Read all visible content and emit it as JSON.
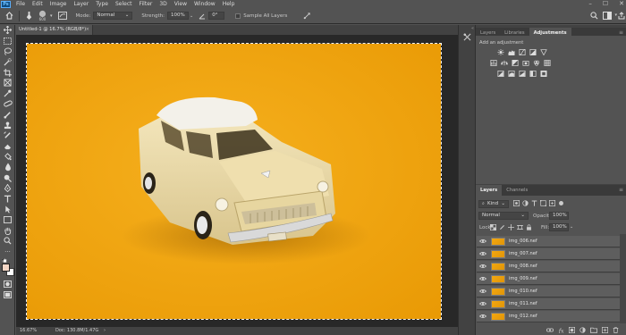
{
  "app": {
    "logo_text": "Ps",
    "menu": [
      "File",
      "Edit",
      "Image",
      "Layer",
      "Type",
      "Select",
      "Filter",
      "3D",
      "View",
      "Window",
      "Help"
    ],
    "window_controls": [
      "–",
      "☐",
      "✕"
    ]
  },
  "options_bar": {
    "brush_size": "600",
    "mode_label": "Mode:",
    "mode_value": "Normal",
    "strength_label": "Strength:",
    "strength_value": "100%",
    "angle_value": "0°",
    "sample_all_label": "Sample All Layers"
  },
  "document": {
    "tab_title": "Untitled-1 @ 16.7% (RGB/8*)",
    "tab_close": "×",
    "zoom": "16.67%",
    "doc_info": "Doc: 130.8M/1.47G"
  },
  "panels": {
    "top_tabs": [
      "Layers",
      "Libraries",
      "Adjustments"
    ],
    "adjustments_hint": "Add an adjustment",
    "layers_tabs": [
      "Layers",
      "Channels"
    ],
    "filter_kind": "Kind",
    "blend_mode": "Normal",
    "opacity_label": "Opacity:",
    "opacity_value": "100%",
    "lock_label": "Lock:",
    "fill_label": "Fill:",
    "fill_value": "100%",
    "layers": [
      {
        "name": "img_006.nef"
      },
      {
        "name": "img_007.nef"
      },
      {
        "name": "img_008.nef"
      },
      {
        "name": "img_009.nef"
      },
      {
        "name": "img_010.nef"
      },
      {
        "name": "img_011.nef"
      },
      {
        "name": "img_012.nef"
      }
    ]
  },
  "colors": {
    "app_bg": "#535353",
    "canvas_bg": "#282828",
    "photo_bg": "#f4a912",
    "car_body": "#efe2b6",
    "car_roof": "#f3f1ea",
    "foreground_swatch": "#f3d6c5",
    "background_swatch": "#ffffff"
  }
}
